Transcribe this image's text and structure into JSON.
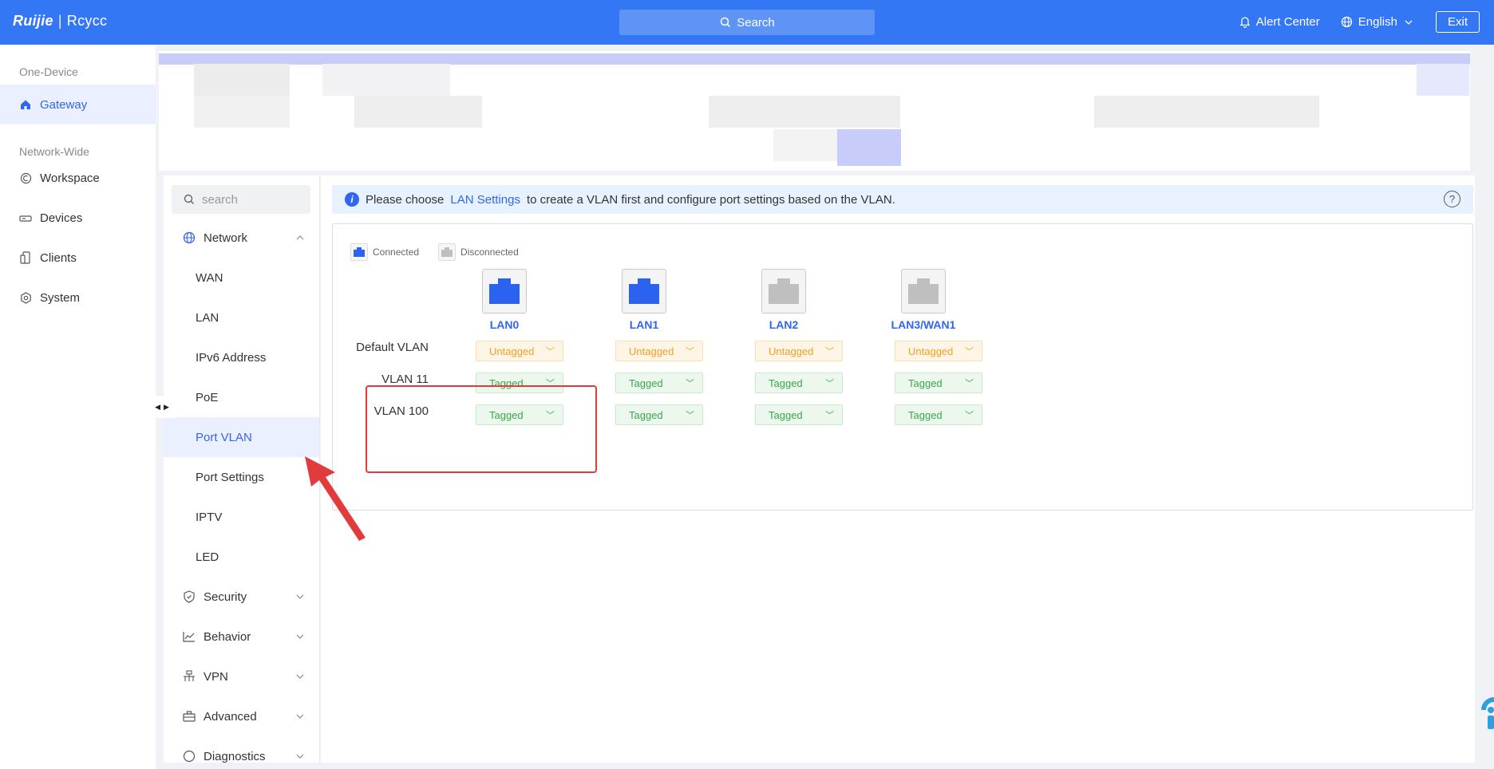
{
  "brand": {
    "logo": "Ruijie",
    "logo_sub": "Rcycc"
  },
  "topbar": {
    "search_label": "Search",
    "alert_center": "Alert Center",
    "language": "English",
    "exit": "Exit"
  },
  "leftnav": {
    "group1": "One-Device",
    "gateway": "Gateway",
    "group2": "Network-Wide",
    "workspace": "Workspace",
    "devices": "Devices",
    "clients": "Clients",
    "system": "System"
  },
  "subnav": {
    "search_placeholder": "search",
    "network": "Network",
    "items": [
      "WAN",
      "LAN",
      "IPv6 Address",
      "PoE",
      "Port VLAN",
      "Port Settings",
      "IPTV",
      "LED"
    ],
    "active_item": "Port VLAN",
    "security": "Security",
    "behavior": "Behavior",
    "vpn": "VPN",
    "advanced": "Advanced",
    "diagnostics": "Diagnostics"
  },
  "info": {
    "prefix": "Please choose",
    "link": "LAN Settings",
    "suffix": "to create a VLAN first and configure port settings based on the VLAN."
  },
  "legend": {
    "connected": "Connected",
    "disconnected": "Disconnected"
  },
  "ports": [
    {
      "name": "LAN0",
      "status": "connected"
    },
    {
      "name": "LAN1",
      "status": "connected"
    },
    {
      "name": "LAN2",
      "status": "disconnected"
    },
    {
      "name": "LAN3/WAN1",
      "status": "disconnected"
    }
  ],
  "vlans": [
    {
      "label": "Default VLAN",
      "modes": [
        "Untagged",
        "Untagged",
        "Untagged",
        "Untagged"
      ]
    },
    {
      "label": "VLAN 11",
      "modes": [
        "Tagged",
        "Tagged",
        "Tagged",
        "Tagged"
      ]
    },
    {
      "label": "VLAN 100",
      "modes": [
        "Tagged",
        "Tagged",
        "Tagged",
        "Tagged"
      ]
    }
  ],
  "colors": {
    "brand_blue": "#3377f5",
    "link_blue": "#3366ee",
    "connected_port": "#2b63f0",
    "disconnected_port": "#bfbfbf",
    "untagged_text": "#f0a020",
    "tagged_text": "#3aa64a",
    "highlight_red": "#e23b3b"
  }
}
